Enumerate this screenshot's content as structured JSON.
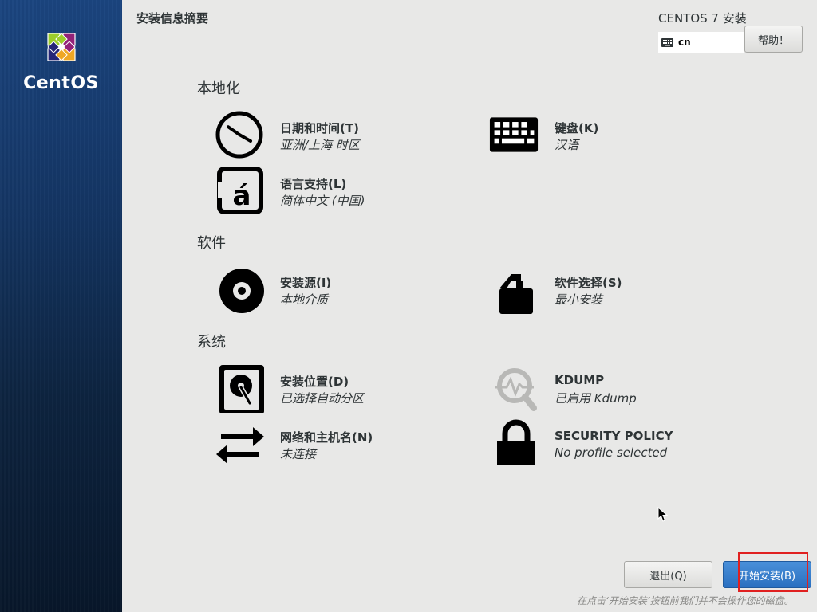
{
  "sidebar": {
    "logo_text": "CentOS"
  },
  "header": {
    "page_title": "安装信息摘要",
    "product_title": "CENTOS 7 安装",
    "keyboard_layout": "cn",
    "help_label": "帮助！"
  },
  "sections": {
    "localization": {
      "title": "本地化",
      "datetime": {
        "title": "日期和时间(T)",
        "status": "亚洲/上海 时区",
        "icon": "clock-icon"
      },
      "keyboard": {
        "title": "键盘(K)",
        "status": "汉语",
        "icon": "keyboard-icon"
      },
      "language": {
        "title": "语言支持(L)",
        "status": "简体中文 (中国)",
        "icon": "language-icon"
      }
    },
    "software": {
      "title": "软件",
      "source": {
        "title": "安装源(I)",
        "status": "本地介质",
        "icon": "disc-icon"
      },
      "selection": {
        "title": "软件选择(S)",
        "status": "最小安装",
        "icon": "package-icon"
      }
    },
    "system": {
      "title": "系统",
      "destination": {
        "title": "安装位置(D)",
        "status": "已选择自动分区",
        "icon": "harddisk-icon"
      },
      "kdump": {
        "title": "KDUMP",
        "status": "已启用 Kdump",
        "icon": "kdump-search-icon"
      },
      "network": {
        "title": "网络和主机名(N)",
        "status": "未连接",
        "icon": "network-arrows-icon"
      },
      "security": {
        "title": "SECURITY POLICY",
        "status": "No profile selected",
        "icon": "lock-icon"
      }
    }
  },
  "footer": {
    "quit_label": "退出(Q)",
    "begin_label": "开始安装(B)",
    "note": "在点击‘开始安装’按钮前我们并不会操作您的磁盘。"
  },
  "colors": {
    "sidebar_top": "#1b4580",
    "sidebar_bottom": "#08172a",
    "background": "#e8e8e7",
    "primary_button": "#2a6fc0",
    "highlight": "#e02020"
  }
}
